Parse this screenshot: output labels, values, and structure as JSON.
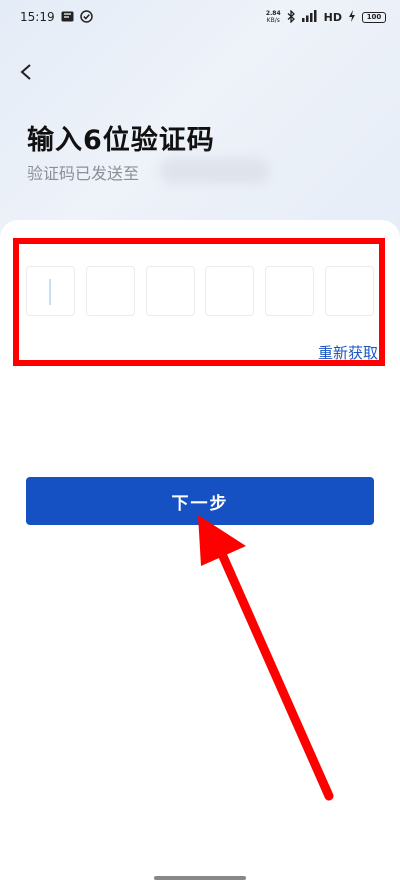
{
  "status_bar": {
    "time": "15:19",
    "left_icons": [
      "message-icon",
      "check-circle-icon"
    ],
    "speed_value": "2.84",
    "speed_unit": "KB/s",
    "network_label": "HD",
    "battery": "100",
    "right_icons": [
      "bluetooth-icon",
      "signal-icon",
      "charging-icon"
    ]
  },
  "header": {
    "back_icon": "chevron-left-icon",
    "title": "输入6位验证码",
    "subtitle": "验证码已发送至"
  },
  "code_input": {
    "digits": [
      "",
      "",
      "",
      "",
      "",
      ""
    ],
    "active_index": 0,
    "resend_label": "重新获取"
  },
  "actions": {
    "next_label": "下一步"
  },
  "colors": {
    "accent": "#1651c4",
    "link": "#1a56c4",
    "annotation": "#ff0000"
  }
}
